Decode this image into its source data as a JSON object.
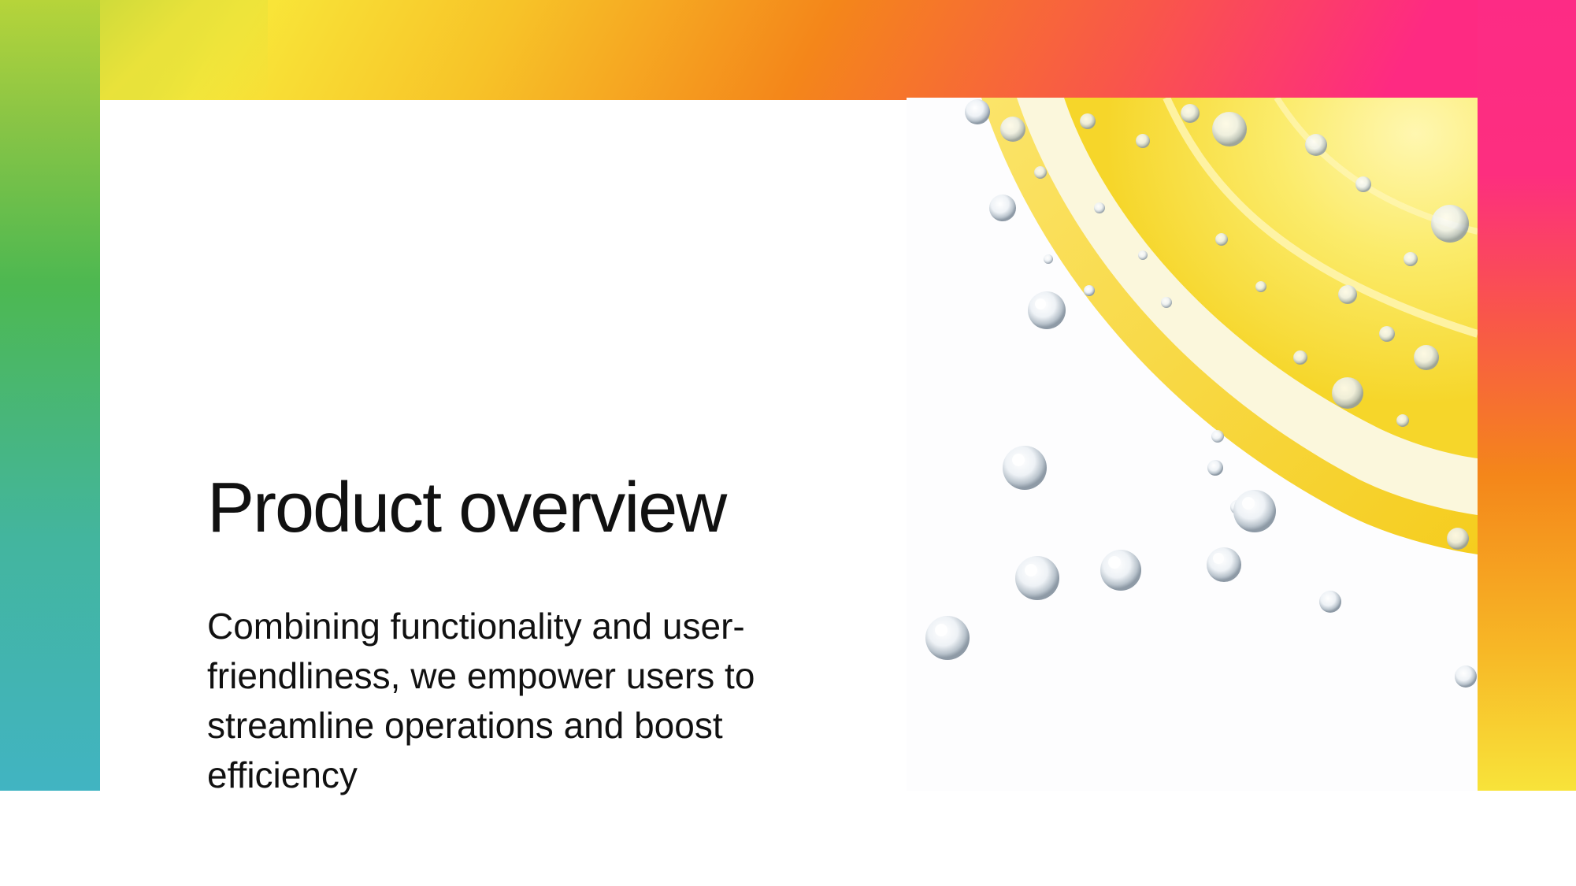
{
  "slide": {
    "title": "Product overview",
    "body": "Combining functionality and user-friendliness, we empower users to streamline operations and boost efficiency"
  },
  "image": {
    "subject": "lemon-slice-with-bubbles"
  },
  "colors": {
    "gradient_green": "#4db851",
    "gradient_yellow": "#f9e93a",
    "gradient_orange": "#f4861a",
    "gradient_pink": "#fd2c86",
    "gradient_teal": "#41b4c2",
    "lemon_yellow": "#f8e23c",
    "text": "#111111"
  }
}
